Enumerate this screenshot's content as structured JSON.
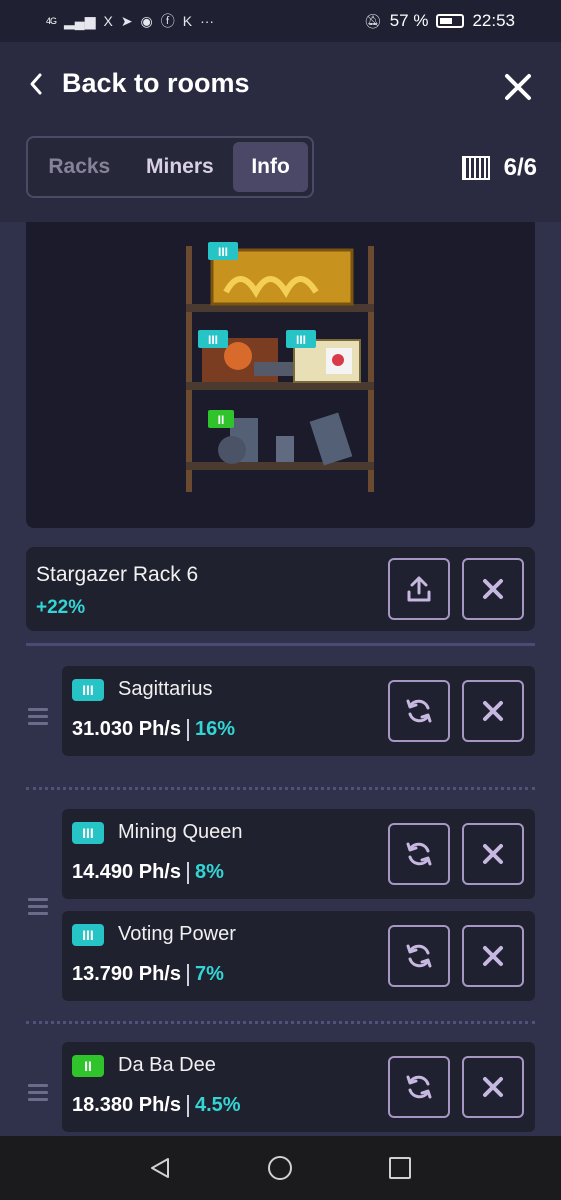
{
  "status_bar": {
    "network": "4G",
    "app_icons": [
      "X",
      "telegram",
      "circle",
      "facebook",
      "K",
      "···"
    ],
    "battery": "57 %",
    "time": "22:53"
  },
  "header": {
    "back_label": "Back to rooms"
  },
  "tabs": [
    {
      "label": "Racks",
      "active": false
    },
    {
      "label": "Miners",
      "active": false
    },
    {
      "label": "Info",
      "active": true
    }
  ],
  "slots": "6/6",
  "rack": {
    "name": "Stargazer Rack 6",
    "bonus": "+22%",
    "levels": [
      "III",
      "III",
      "III",
      "II"
    ]
  },
  "miner_groups": [
    {
      "miners": [
        {
          "level": "III",
          "name": "Sagittarius",
          "power": "31.030 Ph/s",
          "bonus": "16%"
        }
      ]
    },
    {
      "miners": [
        {
          "level": "III",
          "name": "Mining Queen",
          "power": "14.490 Ph/s",
          "bonus": "8%"
        },
        {
          "level": "III",
          "name": "Voting Power",
          "power": "13.790 Ph/s",
          "bonus": "7%"
        }
      ]
    },
    {
      "miners": [
        {
          "level": "II",
          "name": "Da Ba Dee",
          "power": "18.380 Ph/s",
          "bonus": "4.5%"
        }
      ]
    }
  ],
  "colors": {
    "accent_cyan": "#33d5d5",
    "level3_badge": "#27c4c7",
    "level2_badge": "#2fc42c",
    "button_border": "#a696c4"
  }
}
